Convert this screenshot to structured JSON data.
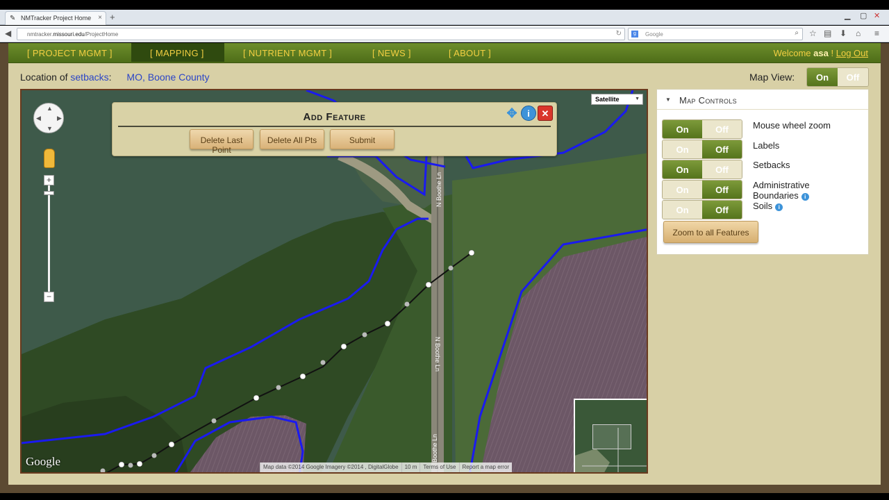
{
  "browser": {
    "tab_title": "NMTracker Project Home",
    "url_host": "nmtracker.",
    "url_domain": "missouri.edu",
    "url_path": "/ProjectHome",
    "search_placeholder": "Google"
  },
  "nav": {
    "items": [
      "[ PROJECT MGMT ]",
      "[ MAPPING ]",
      "[ NUTRIENT MGMT ]",
      "[ NEWS ]",
      "[ ABOUT ]"
    ],
    "active_index": 1,
    "welcome_prefix": "Welcome",
    "username": "asa",
    "welcome_suffix": "!",
    "logout_label": "Log Out"
  },
  "location": {
    "prefix": "Location of",
    "target_link": "setbacks",
    "colon": ":",
    "place_link": "MO, Boone County"
  },
  "map_view": {
    "label": "Map View:",
    "on_label": "On",
    "off_label": "Off",
    "state": "on"
  },
  "map": {
    "type_selector": "Satellite",
    "google_logo": "Google",
    "attribution": [
      "Map data ©2014 Google Imagery ©2014 , DigitalGlobe",
      "10 m",
      "Terms of Use",
      "Report a map error"
    ],
    "road_labels": [
      "N Boothe Ln",
      "N Boothe Ln",
      "Boothe Ln"
    ],
    "colors": {
      "setback_line": "#1a1af0",
      "field_purple": "#6f5a68",
      "crop_green": "#3e5a46"
    }
  },
  "add_feature": {
    "title": "Add Feature",
    "buttons": [
      "Delete Last Point",
      "Delete All Pts",
      "Submit"
    ]
  },
  "map_controls": {
    "title": "Map Controls",
    "on_label": "On",
    "off_label": "Off",
    "rows": [
      {
        "label": "Mouse wheel zoom",
        "state": "on",
        "info": false
      },
      {
        "label": "Labels",
        "state": "off",
        "info": false
      },
      {
        "label": "Setbacks",
        "state": "on",
        "info": false
      },
      {
        "label": "Administrative Boundaries",
        "state": "off",
        "info": true
      },
      {
        "label": "Soils",
        "state": "off",
        "info": true
      }
    ],
    "zoom_button": "Zoom to all Features"
  }
}
